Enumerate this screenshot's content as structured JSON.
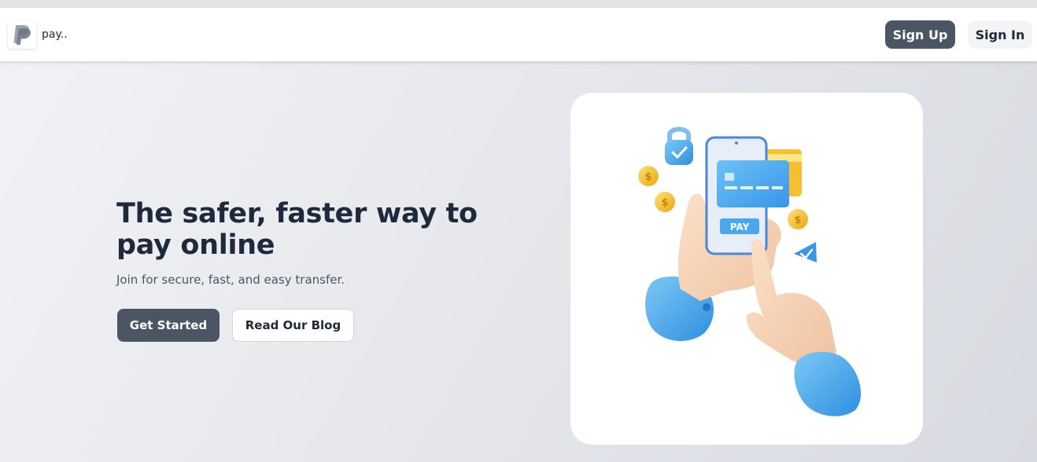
{
  "navbar": {
    "brand": "pay..",
    "logo_icon": "paypal-logo-icon",
    "signup_label": "Sign Up",
    "signin_label": "Sign In"
  },
  "hero": {
    "headline": "The safer, faster way to pay online",
    "subtitle": "Join for secure, fast, and easy transfer.",
    "get_started_label": "Get Started",
    "read_blog_label": "Read Our Blog"
  },
  "illustration": {
    "pay_label": "PAY",
    "icons": [
      "lock-icon",
      "coin-icon",
      "credit-card-icon",
      "phone-icon",
      "hand-icon",
      "checkmark-icon"
    ]
  },
  "colors": {
    "primary_button": "#4b5563",
    "headline": "#1e293b",
    "card_blue": "#4aa8f0",
    "coin_gold": "#f5c02c"
  }
}
